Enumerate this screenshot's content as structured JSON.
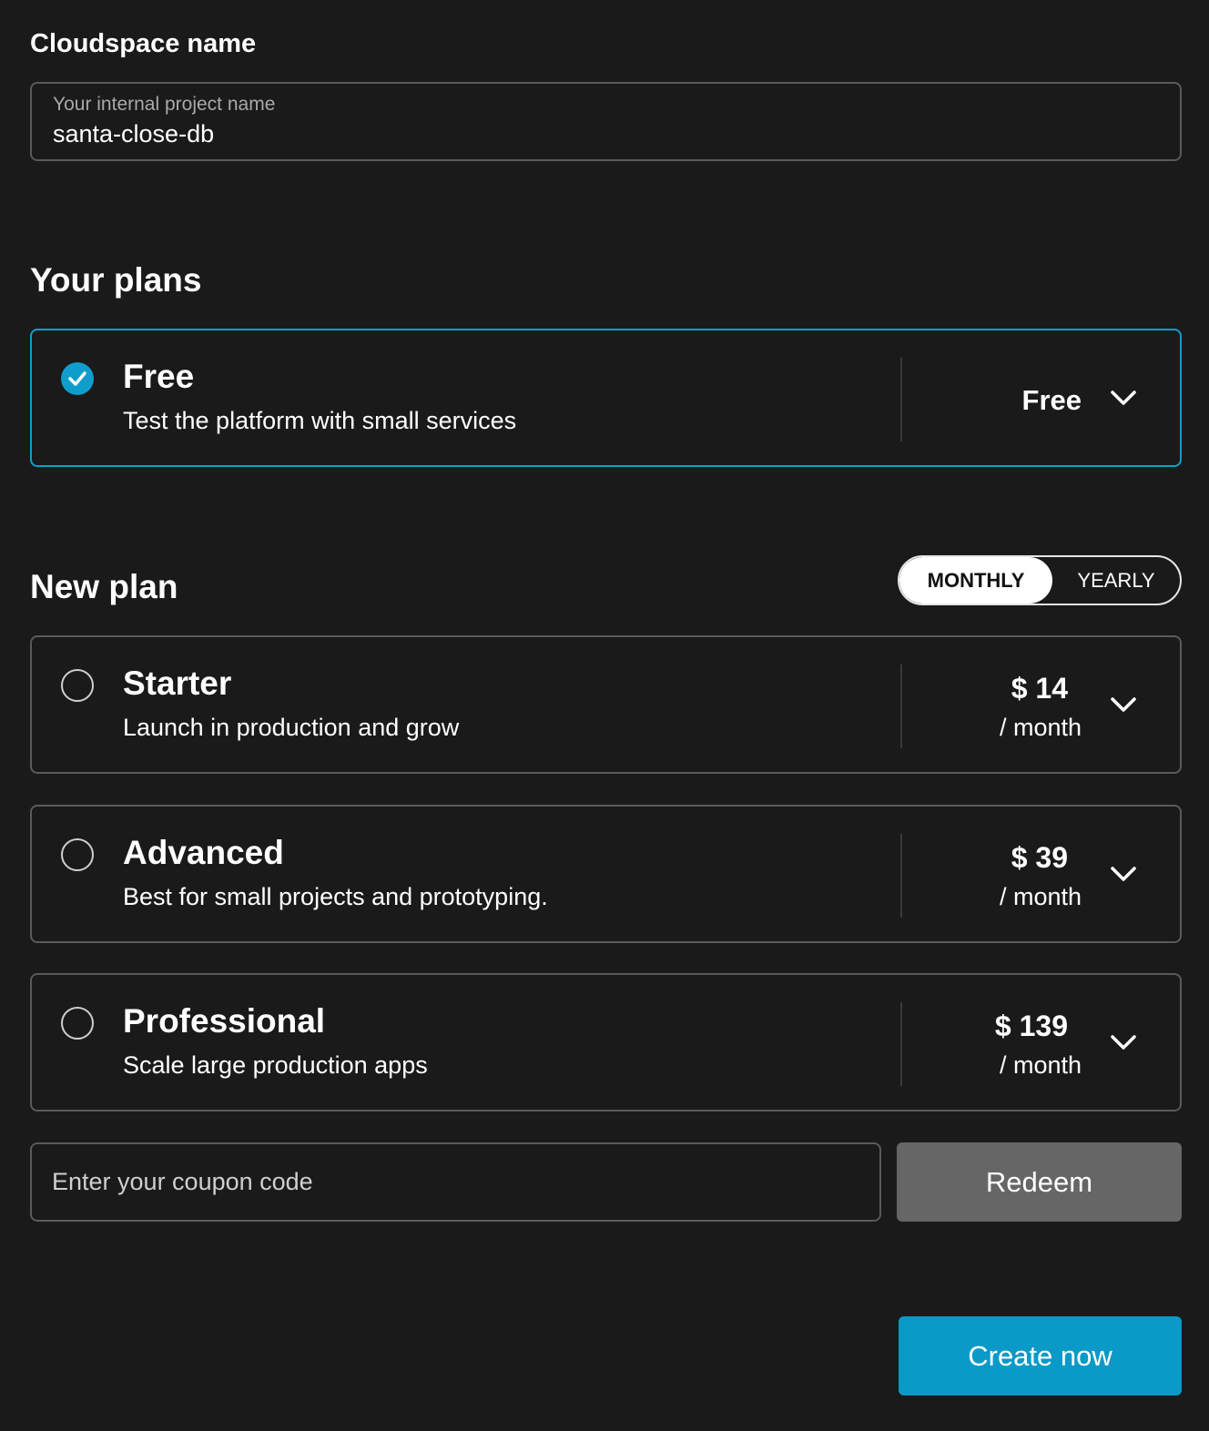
{
  "cloudspace": {
    "label": "Cloudspace name",
    "field_label": "Your internal project name",
    "value": "santa-close-db"
  },
  "your_plans": {
    "title": "Your plans",
    "current": {
      "name": "Free",
      "description": "Test the platform with small services",
      "price": "Free",
      "selected": true
    }
  },
  "new_plan": {
    "title": "New plan",
    "billing_toggle": {
      "options": [
        "MONTHLY",
        "YEARLY"
      ],
      "selected": "MONTHLY"
    },
    "plans": [
      {
        "name": "Starter",
        "description": "Launch in production and grow",
        "price": "$ 14",
        "period": "/ month",
        "selected": false
      },
      {
        "name": "Advanced",
        "description": "Best for small projects and prototyping.",
        "price": "$ 39",
        "period": "/ month",
        "selected": false
      },
      {
        "name": "Professional",
        "description": "Scale large production apps",
        "price": "$ 139",
        "period": "/ month",
        "selected": false
      }
    ]
  },
  "coupon": {
    "placeholder": "Enter your coupon code",
    "redeem_label": "Redeem"
  },
  "actions": {
    "create_label": "Create now"
  },
  "colors": {
    "background": "#1a1a1a",
    "accent": "#0f9ecc",
    "border": "#5a5a5a",
    "redeem_button": "#666666",
    "create_button": "#0a9ac7"
  },
  "icons": {
    "selected_radio": "check-circle-icon",
    "unselected_radio": "radio-empty-icon",
    "expand": "chevron-down-icon"
  }
}
